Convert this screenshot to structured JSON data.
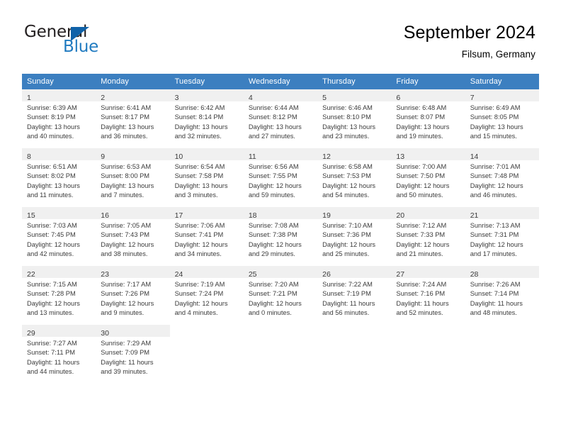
{
  "brand": {
    "name_part1": "General",
    "name_part2": "Blue",
    "logo_icon": "blue-triangle-icon",
    "color_dark": "#231f20",
    "color_blue": "#1f7ac0"
  },
  "header": {
    "title": "September 2024",
    "subtitle": "Filsum, Germany"
  },
  "theme": {
    "header_row_bg": "#3c7fc0",
    "day_number_bg": "#f0f0f0",
    "text_color": "#3b3b3b",
    "grid_line": "#d4d4d4"
  },
  "labels": {
    "sunrise_prefix": "Sunrise:",
    "sunset_prefix": "Sunset:",
    "daylight_prefix": "Daylight:"
  },
  "weekday_headers": [
    "Sunday",
    "Monday",
    "Tuesday",
    "Wednesday",
    "Thursday",
    "Friday",
    "Saturday"
  ],
  "weeks": [
    [
      {
        "day": "1",
        "line1": "Sunrise: 6:39 AM",
        "line2": "Sunset: 8:19 PM",
        "line3": "Daylight: 13 hours",
        "line4": "and 40 minutes."
      },
      {
        "day": "2",
        "line1": "Sunrise: 6:41 AM",
        "line2": "Sunset: 8:17 PM",
        "line3": "Daylight: 13 hours",
        "line4": "and 36 minutes."
      },
      {
        "day": "3",
        "line1": "Sunrise: 6:42 AM",
        "line2": "Sunset: 8:14 PM",
        "line3": "Daylight: 13 hours",
        "line4": "and 32 minutes."
      },
      {
        "day": "4",
        "line1": "Sunrise: 6:44 AM",
        "line2": "Sunset: 8:12 PM",
        "line3": "Daylight: 13 hours",
        "line4": "and 27 minutes."
      },
      {
        "day": "5",
        "line1": "Sunrise: 6:46 AM",
        "line2": "Sunset: 8:10 PM",
        "line3": "Daylight: 13 hours",
        "line4": "and 23 minutes."
      },
      {
        "day": "6",
        "line1": "Sunrise: 6:48 AM",
        "line2": "Sunset: 8:07 PM",
        "line3": "Daylight: 13 hours",
        "line4": "and 19 minutes."
      },
      {
        "day": "7",
        "line1": "Sunrise: 6:49 AM",
        "line2": "Sunset: 8:05 PM",
        "line3": "Daylight: 13 hours",
        "line4": "and 15 minutes."
      }
    ],
    [
      {
        "day": "8",
        "line1": "Sunrise: 6:51 AM",
        "line2": "Sunset: 8:02 PM",
        "line3": "Daylight: 13 hours",
        "line4": "and 11 minutes."
      },
      {
        "day": "9",
        "line1": "Sunrise: 6:53 AM",
        "line2": "Sunset: 8:00 PM",
        "line3": "Daylight: 13 hours",
        "line4": "and 7 minutes."
      },
      {
        "day": "10",
        "line1": "Sunrise: 6:54 AM",
        "line2": "Sunset: 7:58 PM",
        "line3": "Daylight: 13 hours",
        "line4": "and 3 minutes."
      },
      {
        "day": "11",
        "line1": "Sunrise: 6:56 AM",
        "line2": "Sunset: 7:55 PM",
        "line3": "Daylight: 12 hours",
        "line4": "and 59 minutes."
      },
      {
        "day": "12",
        "line1": "Sunrise: 6:58 AM",
        "line2": "Sunset: 7:53 PM",
        "line3": "Daylight: 12 hours",
        "line4": "and 54 minutes."
      },
      {
        "day": "13",
        "line1": "Sunrise: 7:00 AM",
        "line2": "Sunset: 7:50 PM",
        "line3": "Daylight: 12 hours",
        "line4": "and 50 minutes."
      },
      {
        "day": "14",
        "line1": "Sunrise: 7:01 AM",
        "line2": "Sunset: 7:48 PM",
        "line3": "Daylight: 12 hours",
        "line4": "and 46 minutes."
      }
    ],
    [
      {
        "day": "15",
        "line1": "Sunrise: 7:03 AM",
        "line2": "Sunset: 7:45 PM",
        "line3": "Daylight: 12 hours",
        "line4": "and 42 minutes."
      },
      {
        "day": "16",
        "line1": "Sunrise: 7:05 AM",
        "line2": "Sunset: 7:43 PM",
        "line3": "Daylight: 12 hours",
        "line4": "and 38 minutes."
      },
      {
        "day": "17",
        "line1": "Sunrise: 7:06 AM",
        "line2": "Sunset: 7:41 PM",
        "line3": "Daylight: 12 hours",
        "line4": "and 34 minutes."
      },
      {
        "day": "18",
        "line1": "Sunrise: 7:08 AM",
        "line2": "Sunset: 7:38 PM",
        "line3": "Daylight: 12 hours",
        "line4": "and 29 minutes."
      },
      {
        "day": "19",
        "line1": "Sunrise: 7:10 AM",
        "line2": "Sunset: 7:36 PM",
        "line3": "Daylight: 12 hours",
        "line4": "and 25 minutes."
      },
      {
        "day": "20",
        "line1": "Sunrise: 7:12 AM",
        "line2": "Sunset: 7:33 PM",
        "line3": "Daylight: 12 hours",
        "line4": "and 21 minutes."
      },
      {
        "day": "21",
        "line1": "Sunrise: 7:13 AM",
        "line2": "Sunset: 7:31 PM",
        "line3": "Daylight: 12 hours",
        "line4": "and 17 minutes."
      }
    ],
    [
      {
        "day": "22",
        "line1": "Sunrise: 7:15 AM",
        "line2": "Sunset: 7:28 PM",
        "line3": "Daylight: 12 hours",
        "line4": "and 13 minutes."
      },
      {
        "day": "23",
        "line1": "Sunrise: 7:17 AM",
        "line2": "Sunset: 7:26 PM",
        "line3": "Daylight: 12 hours",
        "line4": "and 9 minutes."
      },
      {
        "day": "24",
        "line1": "Sunrise: 7:19 AM",
        "line2": "Sunset: 7:24 PM",
        "line3": "Daylight: 12 hours",
        "line4": "and 4 minutes."
      },
      {
        "day": "25",
        "line1": "Sunrise: 7:20 AM",
        "line2": "Sunset: 7:21 PM",
        "line3": "Daylight: 12 hours",
        "line4": "and 0 minutes."
      },
      {
        "day": "26",
        "line1": "Sunrise: 7:22 AM",
        "line2": "Sunset: 7:19 PM",
        "line3": "Daylight: 11 hours",
        "line4": "and 56 minutes."
      },
      {
        "day": "27",
        "line1": "Sunrise: 7:24 AM",
        "line2": "Sunset: 7:16 PM",
        "line3": "Daylight: 11 hours",
        "line4": "and 52 minutes."
      },
      {
        "day": "28",
        "line1": "Sunrise: 7:26 AM",
        "line2": "Sunset: 7:14 PM",
        "line3": "Daylight: 11 hours",
        "line4": "and 48 minutes."
      }
    ],
    [
      {
        "day": "29",
        "line1": "Sunrise: 7:27 AM",
        "line2": "Sunset: 7:11 PM",
        "line3": "Daylight: 11 hours",
        "line4": "and 44 minutes."
      },
      {
        "day": "30",
        "line1": "Sunrise: 7:29 AM",
        "line2": "Sunset: 7:09 PM",
        "line3": "Daylight: 11 hours",
        "line4": "and 39 minutes."
      },
      {
        "day": "",
        "line1": "",
        "line2": "",
        "line3": "",
        "line4": ""
      },
      {
        "day": "",
        "line1": "",
        "line2": "",
        "line3": "",
        "line4": ""
      },
      {
        "day": "",
        "line1": "",
        "line2": "",
        "line3": "",
        "line4": ""
      },
      {
        "day": "",
        "line1": "",
        "line2": "",
        "line3": "",
        "line4": ""
      },
      {
        "day": "",
        "line1": "",
        "line2": "",
        "line3": "",
        "line4": ""
      }
    ]
  ]
}
